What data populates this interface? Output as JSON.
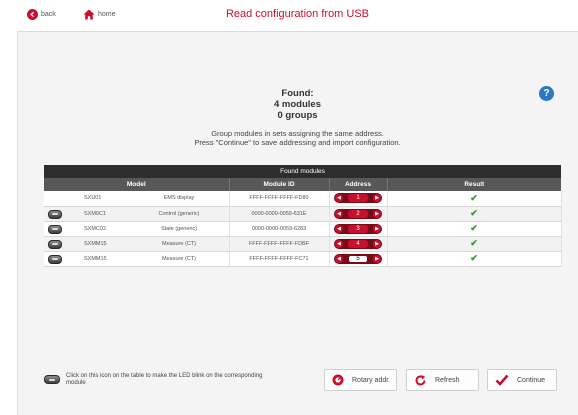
{
  "nav": {
    "back_label": "back",
    "home_label": "home"
  },
  "title": "Read configuration from USB",
  "summary": {
    "found_label": "Found:",
    "modules": "4 modules",
    "groups": "0 groups"
  },
  "help_label": "?",
  "instructions": {
    "line1": "Group modules in sets assigning the same address.",
    "line2": "Press \"Continue\" to save addressing and import configuration."
  },
  "table": {
    "title": "Found modules",
    "columns": [
      "Model",
      "Module ID",
      "Address",
      "Result"
    ],
    "rows": [
      {
        "code": "SXU01",
        "model": "EMS display",
        "module_id": "FFFF-FFFF-FFFF-FD80",
        "address": "1",
        "has_blink": false,
        "result": "ok"
      },
      {
        "code": "SXM0C1",
        "model": "Control (generic)",
        "module_id": "0000-0000-0059-631E",
        "address": "2",
        "has_blink": true,
        "result": "ok"
      },
      {
        "code": "SXMC02",
        "model": "State (generic)",
        "module_id": "0000-0000-0059-6283",
        "address": "3",
        "has_blink": true,
        "result": "ok"
      },
      {
        "code": "SXMM15",
        "model": "Measure (CT)",
        "module_id": "FFFF-FFFF-FFFF-FDBF",
        "address": "4",
        "has_blink": true,
        "result": "ok"
      },
      {
        "code": "SXMM15",
        "model": "Measure (CT)",
        "module_id": "FFFF-FFFF-FFFF-FC71",
        "address": "5",
        "has_blink": true,
        "result": "ok",
        "editing": true
      }
    ]
  },
  "legend": "Click on this icon on the table to make the LED blink on the corresponding module",
  "buttons": {
    "rotary": "Rotary addr.",
    "refresh": "Refresh",
    "continue": "Continue"
  },
  "colors": {
    "accent": "#c8102e",
    "help": "#2b78c4",
    "ok": "#2e9a2e",
    "header_dark": "#2d2d2d",
    "header_mid": "#585858"
  },
  "icons": {
    "back": "back-arrow-icon",
    "home": "home-icon",
    "help": "help-icon",
    "blink": "led-blink-icon",
    "ok": "check-icon",
    "rotary": "rotary-icon",
    "refresh": "refresh-icon",
    "continue": "continue-check-icon"
  }
}
